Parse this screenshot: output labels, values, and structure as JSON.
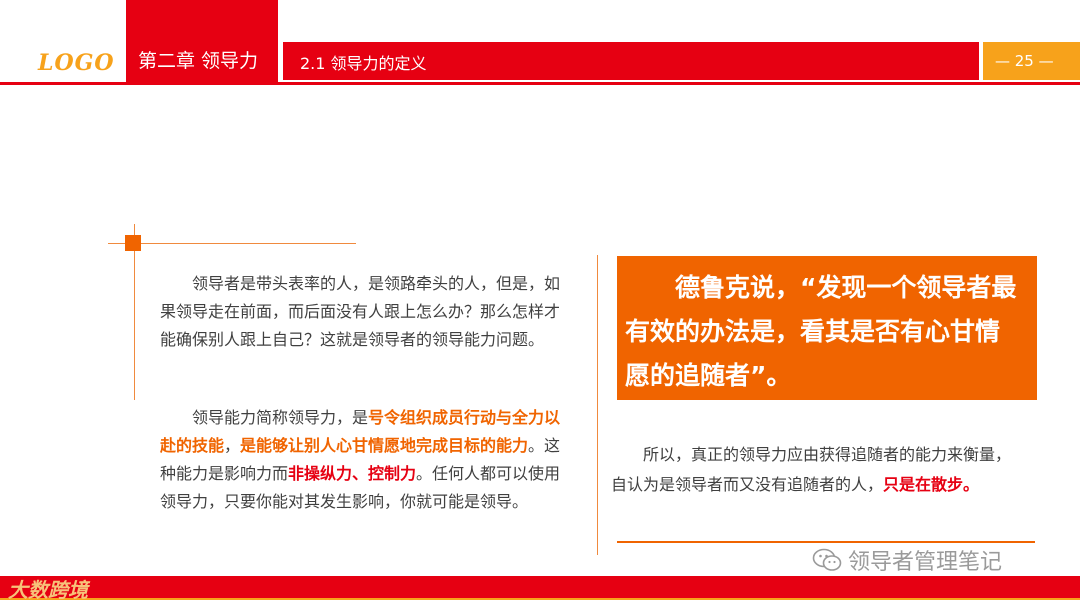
{
  "header": {
    "logo": "LOGO",
    "chapter": "第二章 领导力",
    "section": "2.1 领导力的定义",
    "page": "— 25 —"
  },
  "left": {
    "p1": "领导者是带头表率的人，是领路牵头的人，但是，如果领导走在前面，而后面没有人跟上怎么办？那么怎样才能确保别人跟上自己？这就是领导者的领导能力问题。",
    "p2": {
      "a": "领导能力简称领导力，是",
      "b": "号令组织成员行动与全力以赴的技能",
      "c": "，",
      "d": "是能够让别人心甘情愿地完成目标的能力",
      "e": "。这种能力是影响力而",
      "f": "非操纵力、控制力",
      "g": "。任何人都可以使用领导力，只要你能对其发生影响，你就可能是领导。"
    }
  },
  "right": {
    "quote": "德鲁克说，“发现一个领导者最有效的办法是，看其是否有心甘情愿的追随者”。",
    "p3": {
      "a": "所以，真正的领导力应由获得追随者的能力来衡量，自认为是领导者而又没有追随者的人，",
      "b": "只是在散步。"
    }
  },
  "watermark": "领导者管理笔记",
  "footer_logo": "大数跨境",
  "colors": {
    "red": "#e60012",
    "orange": "#f06400",
    "gold": "#f7a21b"
  }
}
